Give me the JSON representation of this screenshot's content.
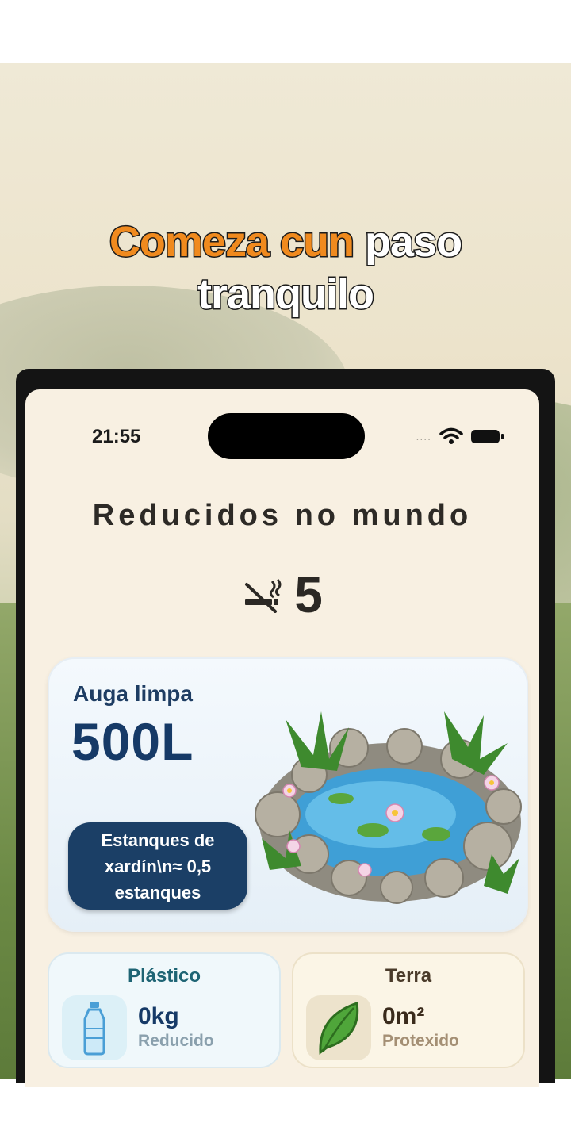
{
  "headline": {
    "part1": "Comeza cun",
    "part2": "paso",
    "part3": "tranquilo"
  },
  "status_bar": {
    "time": "21:55",
    "signal": "....",
    "icons": [
      "wifi-icon",
      "battery-icon"
    ]
  },
  "main": {
    "title": "Reducidos no mundo",
    "count_icon": "no-smoking-icon",
    "count": "5"
  },
  "water_card": {
    "label": "Auga limpa",
    "value": "500L",
    "badge": "Estanques de xardín\\n≈ 0,5 estanques",
    "image": "garden-pond-illustration"
  },
  "stats": [
    {
      "title": "Plástico",
      "value": "0kg",
      "sub": "Reducido",
      "icon": "water-bottle-icon"
    },
    {
      "title": "Terra",
      "value": "0m²",
      "sub": "Protexido",
      "icon": "leaf-icon"
    }
  ],
  "colors": {
    "accent_orange": "#f08a1e",
    "navy": "#163a67",
    "screen_bg": "#f8f0e2"
  }
}
